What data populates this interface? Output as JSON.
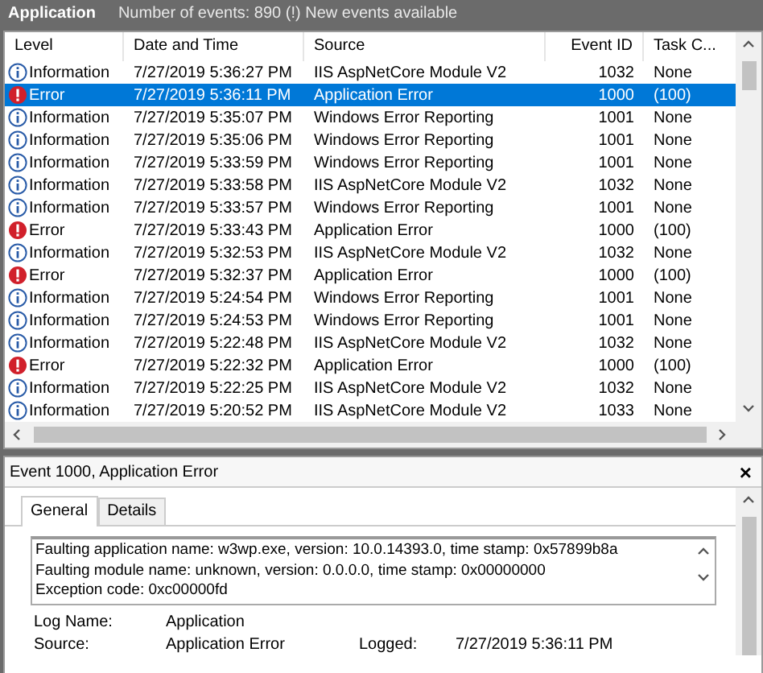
{
  "header": {
    "title": "Application",
    "summary": "Number of events: 890 (!) New events available"
  },
  "table": {
    "columns": [
      "Level",
      "Date and Time",
      "Source",
      "Event ID",
      "Task C..."
    ],
    "rows": [
      {
        "kind": "information",
        "level": "Information",
        "time": "7/27/2019 5:36:27 PM",
        "source": "IIS AspNetCore Module V2",
        "event_id": "1032",
        "task": "None",
        "selected": false
      },
      {
        "kind": "error",
        "level": "Error",
        "time": "7/27/2019 5:36:11 PM",
        "source": "Application Error",
        "event_id": "1000",
        "task": "(100)",
        "selected": true
      },
      {
        "kind": "information",
        "level": "Information",
        "time": "7/27/2019 5:35:07 PM",
        "source": "Windows Error Reporting",
        "event_id": "1001",
        "task": "None",
        "selected": false
      },
      {
        "kind": "information",
        "level": "Information",
        "time": "7/27/2019 5:35:06 PM",
        "source": "Windows Error Reporting",
        "event_id": "1001",
        "task": "None",
        "selected": false
      },
      {
        "kind": "information",
        "level": "Information",
        "time": "7/27/2019 5:33:59 PM",
        "source": "Windows Error Reporting",
        "event_id": "1001",
        "task": "None",
        "selected": false
      },
      {
        "kind": "information",
        "level": "Information",
        "time": "7/27/2019 5:33:58 PM",
        "source": "IIS AspNetCore Module V2",
        "event_id": "1032",
        "task": "None",
        "selected": false
      },
      {
        "kind": "information",
        "level": "Information",
        "time": "7/27/2019 5:33:57 PM",
        "source": "Windows Error Reporting",
        "event_id": "1001",
        "task": "None",
        "selected": false
      },
      {
        "kind": "error",
        "level": "Error",
        "time": "7/27/2019 5:33:43 PM",
        "source": "Application Error",
        "event_id": "1000",
        "task": "(100)",
        "selected": false
      },
      {
        "kind": "information",
        "level": "Information",
        "time": "7/27/2019 5:32:53 PM",
        "source": "IIS AspNetCore Module V2",
        "event_id": "1032",
        "task": "None",
        "selected": false
      },
      {
        "kind": "error",
        "level": "Error",
        "time": "7/27/2019 5:32:37 PM",
        "source": "Application Error",
        "event_id": "1000",
        "task": "(100)",
        "selected": false
      },
      {
        "kind": "information",
        "level": "Information",
        "time": "7/27/2019 5:24:54 PM",
        "source": "Windows Error Reporting",
        "event_id": "1001",
        "task": "None",
        "selected": false
      },
      {
        "kind": "information",
        "level": "Information",
        "time": "7/27/2019 5:24:53 PM",
        "source": "Windows Error Reporting",
        "event_id": "1001",
        "task": "None",
        "selected": false
      },
      {
        "kind": "information",
        "level": "Information",
        "time": "7/27/2019 5:22:48 PM",
        "source": "IIS AspNetCore Module V2",
        "event_id": "1032",
        "task": "None",
        "selected": false
      },
      {
        "kind": "error",
        "level": "Error",
        "time": "7/27/2019 5:22:32 PM",
        "source": "Application Error",
        "event_id": "1000",
        "task": "(100)",
        "selected": false
      },
      {
        "kind": "information",
        "level": "Information",
        "time": "7/27/2019 5:22:25 PM",
        "source": "IIS AspNetCore Module V2",
        "event_id": "1032",
        "task": "None",
        "selected": false
      },
      {
        "kind": "information",
        "level": "Information",
        "time": "7/27/2019 5:20:52 PM",
        "source": "IIS AspNetCore Module V2",
        "event_id": "1033",
        "task": "None",
        "selected": false
      }
    ]
  },
  "detail": {
    "title": "Event 1000, Application Error",
    "close": "×",
    "tabs": [
      {
        "label": "General",
        "selected": true
      },
      {
        "label": "Details",
        "selected": false
      }
    ],
    "message": [
      "Faulting application name: w3wp.exe, version: 10.0.14393.0, time stamp: 0x57899b8a",
      "Faulting module name: unknown, version: 0.0.0.0, time stamp: 0x00000000",
      "Exception code: 0xc00000fd"
    ],
    "fields": [
      {
        "label": "Log Name:",
        "value": "Application"
      },
      {
        "label": "Source:",
        "value": "Application Error",
        "label_2": "Logged:",
        "value_2": "7/27/2019 5:36:11 PM"
      }
    ]
  }
}
